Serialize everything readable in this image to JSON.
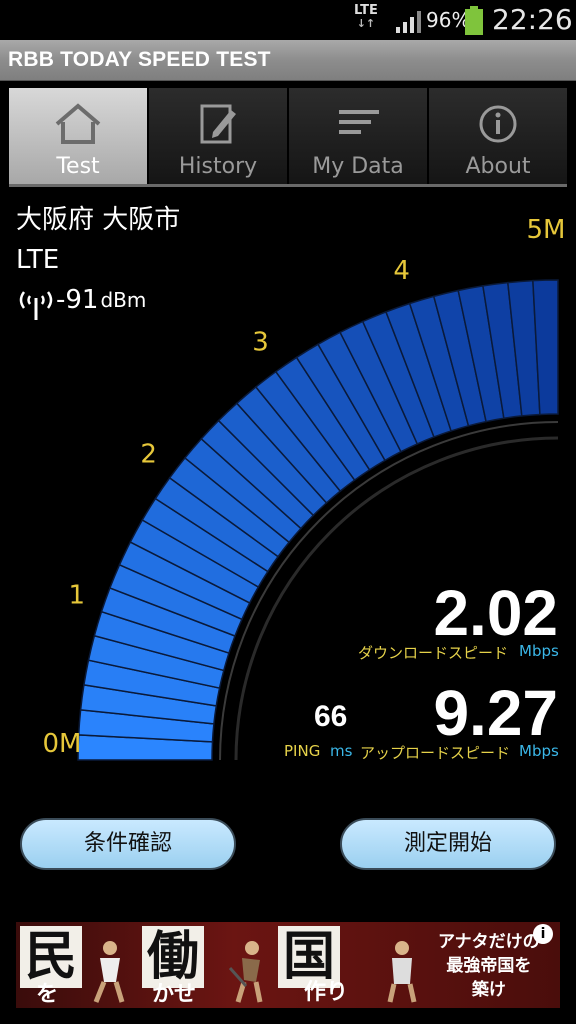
{
  "status_bar": {
    "network": "LTE",
    "battery_percent": "96%",
    "time": "22:26"
  },
  "app": {
    "title": "RBB TODAY SPEED TEST"
  },
  "tabs": [
    {
      "label": "Test",
      "icon": "home-icon",
      "active": true
    },
    {
      "label": "History",
      "icon": "edit-icon",
      "active": false
    },
    {
      "label": "My Data",
      "icon": "list-icon",
      "active": false
    },
    {
      "label": "About",
      "icon": "info-icon",
      "active": false
    }
  ],
  "location": {
    "area": "大阪府 大阪市",
    "network_type": "LTE",
    "signal_value": "-91",
    "signal_unit": "dBm"
  },
  "gauge": {
    "scale_labels": [
      "0M",
      "1",
      "2",
      "3",
      "4",
      "5M"
    ],
    "max": 5,
    "level": 5,
    "colors": {
      "bar_light": "#2b86ff",
      "bar_dark": "#0c3a9c",
      "labels": "#e6c73a"
    }
  },
  "results": {
    "download": {
      "value": "2.02",
      "label": "ダウンロードスピード",
      "unit": "Mbps"
    },
    "upload": {
      "value": "9.27",
      "label": "アップロードスピード",
      "unit": "Mbps"
    },
    "ping": {
      "value": "66",
      "label": "PING",
      "unit": "ms"
    }
  },
  "buttons": {
    "conditions": "条件確認",
    "start": "測定開始"
  },
  "ad": {
    "tiles": [
      "民",
      "働",
      "国"
    ],
    "sub_texts": [
      "を",
      "かせ",
      "作り"
    ],
    "copy_line1": "アナタだけの",
    "copy_line2": "最強帝国を",
    "copy_line3": "築け",
    "info": "i"
  }
}
